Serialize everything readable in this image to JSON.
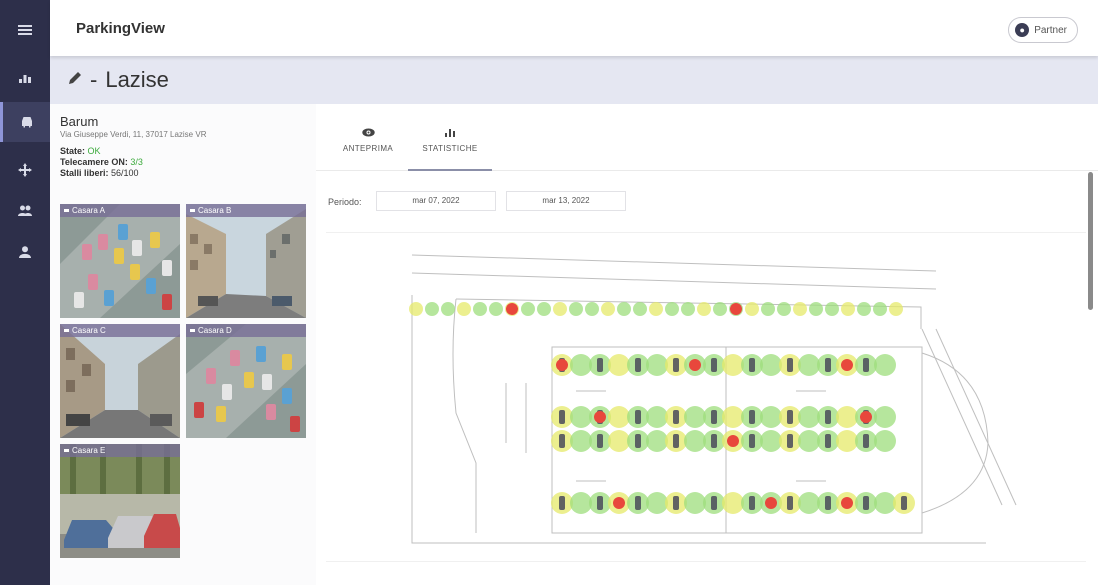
{
  "app": {
    "title": "ParkingView"
  },
  "header": {
    "partner_label": "Partner"
  },
  "page": {
    "title": "Lazise",
    "title_prefix": "-"
  },
  "rail": {
    "items": [
      {
        "icon": "menu-icon",
        "active": false
      },
      {
        "icon": "chart-icon",
        "active": false
      },
      {
        "icon": "car-icon",
        "active": true
      },
      {
        "icon": "move-icon",
        "active": false
      },
      {
        "icon": "group-icon",
        "active": false
      },
      {
        "icon": "person-icon",
        "active": false
      }
    ]
  },
  "lot": {
    "name": "Barum",
    "address": "Via Giuseppe Verdi, 11, 37017 Lazise VR",
    "state_label": "State:",
    "state_value": "OK",
    "cameras_label": "Telecamere ON:",
    "cameras_value": "3/3",
    "free_label": "Stalli liberi:",
    "free_value": "56/100"
  },
  "cameras": [
    {
      "label": "Casara A",
      "kind": "top"
    },
    {
      "label": "Casara B",
      "kind": "street"
    },
    {
      "label": "Casara C",
      "kind": "street"
    },
    {
      "label": "Casara D",
      "kind": "top"
    },
    {
      "label": "Casara E",
      "kind": "cars"
    }
  ],
  "tabs": [
    {
      "label": "ANTEPRIMA",
      "icon": "eye-icon",
      "active": false
    },
    {
      "label": "STATISTICHE",
      "icon": "bar-chart-icon",
      "active": true
    }
  ],
  "period": {
    "label": "Periodo:",
    "start": "mar 07, 2022",
    "end": "mar 13, 2022"
  },
  "colors": {
    "rail": "#2d2f4a",
    "ok_green": "#3caa3c",
    "heat_low": "#7fd46a",
    "heat_mid": "#e6ea6a",
    "heat_high": "#e8473c"
  }
}
